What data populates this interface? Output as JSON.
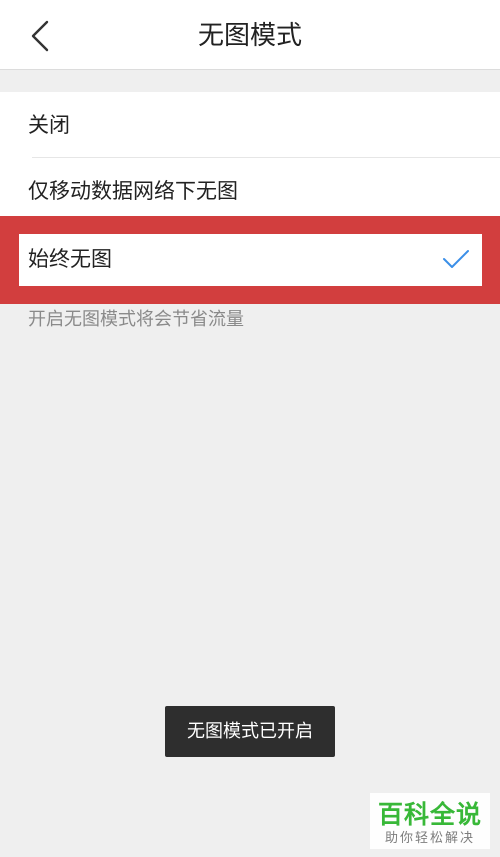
{
  "header": {
    "title": "无图模式",
    "back_icon": "chevron-left-icon"
  },
  "options": [
    {
      "label": "关闭",
      "selected": false
    },
    {
      "label": "仅移动数据网络下无图",
      "selected": false
    },
    {
      "label": "始终无图",
      "selected": true
    }
  ],
  "check_icon": "checkmark-icon",
  "hint": "开启无图模式将会节省流量",
  "toast": "无图模式已开启",
  "watermark": {
    "title": "百科全说",
    "subtitle": "助你轻松解决"
  },
  "colors": {
    "highlight": "#d23e3e",
    "check": "#3b8fe8",
    "watermark_green": "#2fb62f",
    "toast_bg": "#2e2e2e",
    "page_bg": "#efefef"
  }
}
